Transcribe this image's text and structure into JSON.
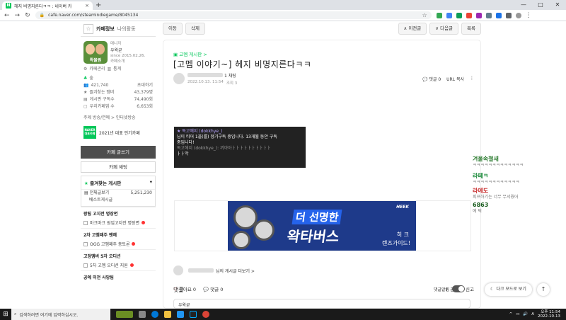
{
  "browser": {
    "tab_title": "헤지 비명지른다ㅋㅋ : 네이버 카",
    "tab_close": "×",
    "new_tab": "+",
    "url": "cafe.naver.com/steamindiegame/8045134",
    "window_controls": [
      "—",
      "□",
      "✕"
    ]
  },
  "sidebar": {
    "tab_cafe_info": "카페정보",
    "tab_my_activity": "나의활동",
    "cafe_logo_label": "왁물원",
    "manager_label": "매니저",
    "manager_name": "우왁굳",
    "since": "since 2015.02.26.",
    "cafe_intro": "카페소개",
    "cafe_manage": "카페관리",
    "stats": "통계",
    "grade": "숲",
    "member_count": "421,740",
    "invite": "초대하기",
    "favorite_members_label": "즐겨찾는 멤버",
    "favorite_members_value": "43,379명",
    "post_subscribe_label": "게시판 구독수",
    "post_subscribe_value": "74,490회",
    "inquiry_label": "우리카페앱 수",
    "inquiry_value": "6,653회",
    "theme_line": "주제  방송/연예 > 인터넷방송",
    "award_badge": "NAVER 대표카페",
    "award_text": "2021년 대표 인기카페",
    "write_button": "카페 글쓰기",
    "chat_button": "카페 채팅",
    "fav_board_title": "즐겨찾는 게시판",
    "fav_boards": [
      {
        "name": "전체글보기",
        "count": "5,251,230"
      },
      {
        "name": "베스트게시글",
        "count": ""
      }
    ],
    "sections": [
      {
        "title": "왕팀 고지전 명장면",
        "item": "마크마크 원업고지전 명장면"
      },
      {
        "title": "2차 고멤패주 밴헤",
        "item": "OGG 고멤패주 총토론"
      },
      {
        "title": "고정멤버 5차 오디션",
        "item": "5차 고멤 오디션 지원"
      },
      {
        "title": "공예 미전 사망팀",
        "item": ""
      }
    ]
  },
  "main": {
    "btn_move": "이동",
    "btn_delete": "삭제",
    "btn_prev": "∧ 이전글",
    "btn_next": "∨ 다음글",
    "btn_list": "목록",
    "board_link": "고멤 게시판 >",
    "title": "[고멤 이야기~] 헤지 비명지른다ㅋㅋ",
    "author_level": "1 채팅",
    "post_date": "2022.10.13. 11:54",
    "views": "조회 3",
    "comment_count_label": "댓글 0",
    "url_copy": "URL 복사",
    "more": "⋮",
    "embed_lines": [
      {
        "cls": "hl",
        "text": "★ 독고헤지 (dokkhye_)"
      },
      {
        "cls": "",
        "text": "님이 티어 1을(를) 정기구독 중입니다. 13개월 동안 구독"
      },
      {
        "cls": "",
        "text": "중입니다!"
      },
      {
        "cls": "hl2",
        "text": "독고헤지 (dokkhye_): 끼야아ㅏㅏㅏㅏㅏㅏㅏㅏㅏㅏ"
      },
      {
        "cls": "",
        "text": "ㅏㅏ악"
      }
    ],
    "banner_brand": "HEEK",
    "banner_line1": "더 선명한",
    "banner_line2": "왁타버스",
    "banner_side1": "히 크",
    "banner_side2": "렌즈가이드!",
    "profile_more": "님의 게시글 더보기 >",
    "like_label": "좋아요 0",
    "comment_label": "댓글 0",
    "share": "공유",
    "report": "신고",
    "comment_header": "댓글",
    "comment_toggle": "댓글알림",
    "comment_preview": "우왁굳"
  },
  "chat": [
    {
      "name": "겨울속철새",
      "color": "#2e7d32",
      "msg": "ㅋㅋㅋㅋㅋㅋㅋㅋㅋㅋㅋㅋㅋ"
    },
    {
      "name": "라떼ㅋ",
      "color": "#1b8a3a",
      "msg": "ㅋㅋㅋㅋㅋㅋㅋㅋㅋㅋㅋㅋ"
    },
    {
      "name": "라에도",
      "color": "#c62828",
      "msg": "피프하기는 너무 무서웠어"
    },
    {
      "name": "6863",
      "color": "#1b5e20",
      "msg": "에 픽"
    }
  ],
  "floating": {
    "dark_mode": "다크 모드로 보기",
    "top": "↑"
  },
  "taskbar": {
    "search_placeholder": "검색하려면 여기에 입력하십시오.",
    "time": "오후 11:54",
    "date": "2022-10-13",
    "lang": "A"
  }
}
